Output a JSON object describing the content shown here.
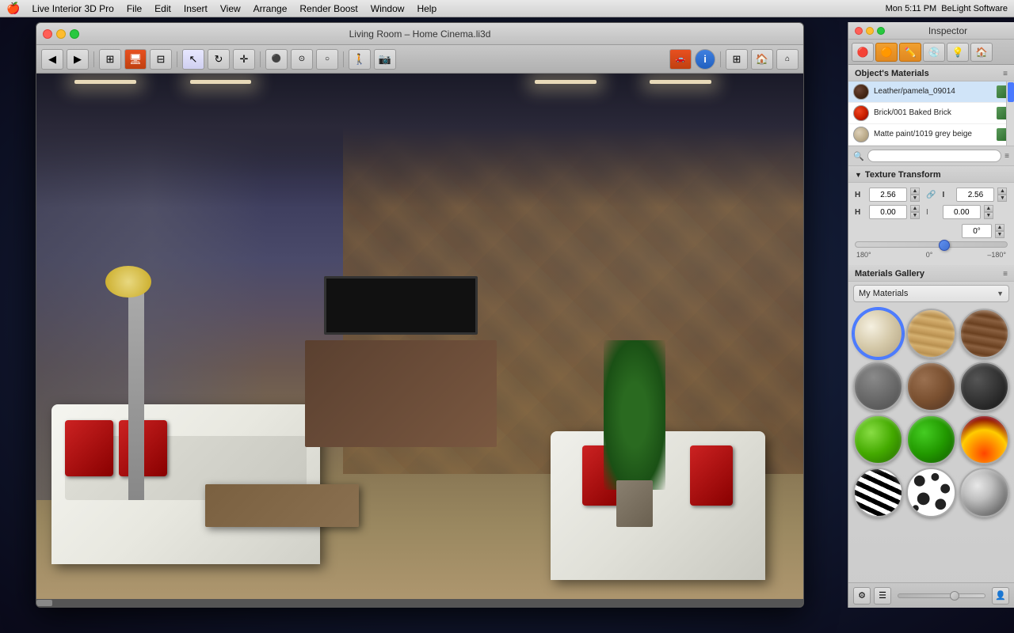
{
  "menubar": {
    "apple": "🍎",
    "items": [
      "Live Interior 3D Pro",
      "File",
      "Edit",
      "Insert",
      "View",
      "Arrange",
      "Render Boost",
      "Window",
      "Help"
    ],
    "right": {
      "time": "Mon 5:11 PM",
      "company": "BeLight Software"
    }
  },
  "window": {
    "title": "Living Room – Home Cinema.li3d",
    "traffic_lights": [
      "red",
      "yellow",
      "green"
    ]
  },
  "inspector": {
    "title": "Inspector",
    "tabs": [
      "red-icon",
      "orange-icon",
      "pencil-icon",
      "material-icon",
      "light-icon",
      "house-icon"
    ],
    "objects_materials_label": "Object's Materials",
    "materials": [
      {
        "name": "Leather/pamela_09014",
        "color": "#4a3528",
        "type": "leather"
      },
      {
        "name": "Brick/001 Baked Brick",
        "color": "#cc3311",
        "type": "brick"
      },
      {
        "name": "Matte paint/1019 grey beige",
        "color": "#c8b89a",
        "type": "paint"
      }
    ],
    "texture_transform": {
      "label": "Texture Transform",
      "h1_value": "2.56",
      "h2_value": "0.00",
      "v1_value": "2.56",
      "v2_value": "0.00",
      "angle_value": "0°",
      "angle_min": "180°",
      "angle_mid": "0°",
      "angle_max": "–180°"
    },
    "gallery": {
      "label": "Materials Gallery",
      "dropdown_label": "My Materials",
      "items": [
        "cream",
        "wood-light",
        "wood-dark",
        "concrete",
        "brown-sphere",
        "dark-sphere",
        "green-bright",
        "green-dark",
        "fire",
        "zebra",
        "dalmatian",
        "silver"
      ]
    },
    "bottom": {
      "gear_label": "⚙",
      "list_label": "☰",
      "person_label": "👤"
    }
  }
}
